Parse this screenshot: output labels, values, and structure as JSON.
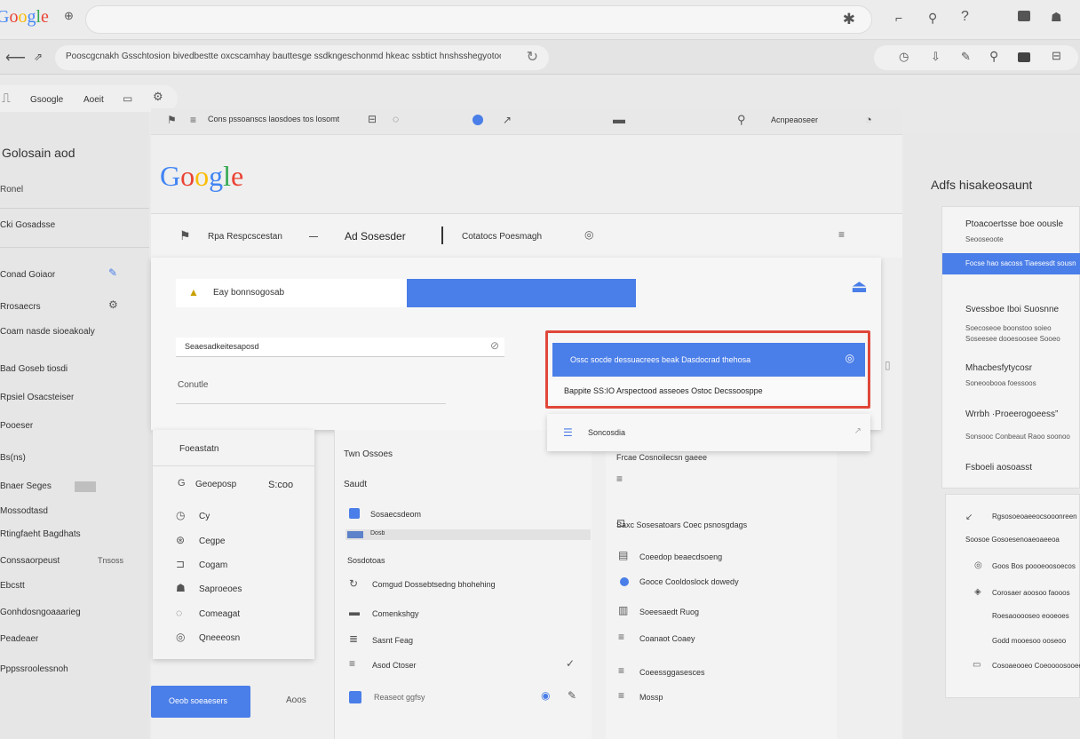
{
  "browser": {
    "logo": "Google",
    "search_value": "",
    "address_text": "Pooscgcnakh Gsschtosion bivedbestte oxcscamhay bauttesge ssdkngeschonmd hkeac ssbtict hnshsshegyotoolmsgdt",
    "top_icons": [
      "puzzle-icon",
      "cast-icon",
      "pin-icon",
      "help-icon",
      "window-icon",
      "account-icon"
    ],
    "nav_icons": [
      "history-icon",
      "download-icon",
      "tag-icon",
      "search-icon",
      "window-icon",
      "apps-icon"
    ]
  },
  "left_panel": {
    "tab_google": "Gsoogle",
    "tab_ads": "Aoeit",
    "title": "Golosain aod",
    "subtitle": "Ronel",
    "items": [
      "Cki   Gosadsse",
      "Conad Goiaor",
      "Rrosaecrs",
      "Coam nasde sioeakoaly",
      "Bad Goseb tiosdi",
      "Rpsiel Osacsteiser",
      "Pooeser",
      "Bs(ns)",
      "Bnaer Seges",
      "Mossodtasd",
      "Rtingfaeht Bagdhats",
      "Conssaorpeust",
      "Ebcstt",
      "Gonhdosngoaaarieg",
      "Peadeaer",
      "Pppssroolessnoh"
    ],
    "extra_label": "Tnsoss"
  },
  "toolbar": {
    "breadcrumb": "Cons pssoanscs laosdoes tos losomt",
    "account_text": "Acnpeaoseer"
  },
  "main": {
    "tabs": [
      "Rpa  Respcscestan",
      "Ad  Sosesder",
      "Cotatocs Poesmagh"
    ],
    "search_label": "Eay bonnsogosab",
    "input_value": "Seaesadkeitesaposd",
    "field_label": "Conutle",
    "sub_header": "Foeastatn",
    "sub_items": [
      "Geoeposp",
      "Cy",
      "Cegpe",
      "Cogam",
      "Saproeoes",
      "Comeagat",
      "Qneeeosn"
    ],
    "sub_extra": "S:coo",
    "primary_button": "Oeob soeaesers",
    "secondary_label": "Aoos"
  },
  "dropdown": {
    "selected": "Ossc socde dessuacrees beak Dasdocrad thehosa",
    "highlight_text": "Bappite SS:IO   Arspectood asseoes Ostoc Decssoosppe",
    "option": "Soncosdia"
  },
  "middle_col": {
    "header": "Twn Ossoes",
    "label": "Saudt",
    "items": [
      "Sosaecsdeom",
      "Dosb",
      "Sosdotoas",
      "Comgud Dossebtsedng bhohehing",
      "Comenkshgy",
      "Sasnt Feag",
      "Asod Ctoser",
      "Reaseot ggfsy"
    ]
  },
  "right_col": {
    "items": [
      "Frcae  Cosnoilecsn gaeee",
      "Saxc  Sosesatoars  Coec psnosgdags",
      "Coeedop beaecdsoeng",
      "Gooce Cooldoslock dowedy",
      "Soeesaedt Ruog",
      "Coanaot Coaey",
      "Coeessggasesces",
      "Mossp"
    ]
  },
  "ads_panel": {
    "title": "Adfs hisakeosaunt",
    "card1_title": "Ptoacoertsse boe oousle",
    "card1_sub": "Seooseoote",
    "card1_button": "Focse hao sacoss Tiaesesdt sousn",
    "card2_title": "Svessboe Iboi Suosnne",
    "card2_lines": [
      "Soecoseoe boonstoo soieo",
      "Soseesee dooesoosee Sooeo"
    ],
    "card3_title": "Mhacbesfytycosr",
    "card3_sub": "Soneoobooa foessoos",
    "card4_title": "Wrrbh ·Proeerogoeess”",
    "card4_sub": "Sonsooc  Conbeaut Raoo soonoo",
    "card5_title": "Fsboeli aosoasst",
    "list": [
      "Rgsosoeoaeeocsooonreen",
      "Soosoe  Gosoesenoaeoaeeoa",
      "Goos Bos poooeoosoecos",
      "Corosaer aoosoo faooos",
      "Roesaooooseo eooeoes",
      "Godd mooesoo ooseoo",
      "Cosoaeooeo Coeoooosooeesso"
    ]
  },
  "colors": {
    "accent_blue": "#4a7ee8",
    "alert_red": "#e0473a",
    "panel_bg": "#f2f2f2"
  }
}
